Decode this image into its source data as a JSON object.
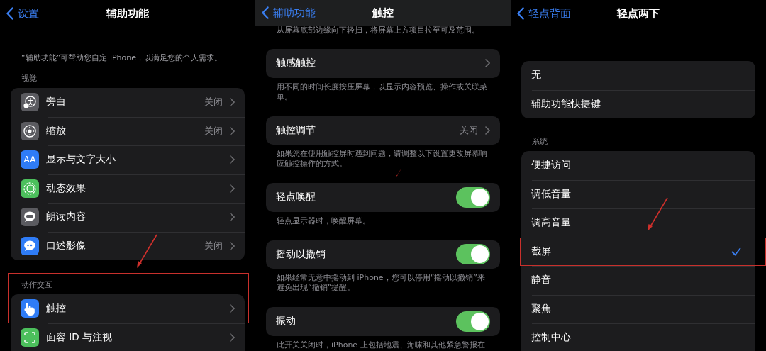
{
  "panels": [
    {
      "back": "设置",
      "title": "辅助功能",
      "scrolled": false,
      "intro": "“辅助功能”可帮助您自定 iPhone，以满足您的个人需求。",
      "groups": [
        {
          "header": "视觉",
          "rows": [
            {
              "label": "旁白",
              "kind": "link",
              "value": "关闭",
              "highlighted": false
            },
            {
              "label": "缩放",
              "kind": "link",
              "value": "关闭",
              "highlighted": false
            },
            {
              "label": "显示与文字大小",
              "kind": "link",
              "icon_text": "AA",
              "highlighted": false
            },
            {
              "label": "动态效果",
              "kind": "link",
              "highlighted": false
            },
            {
              "label": "朗读内容",
              "kind": "link",
              "highlighted": false
            },
            {
              "label": "口述影像",
              "kind": "link",
              "value": "关闭",
              "highlighted": false
            }
          ]
        },
        {
          "header": "动作交互",
          "rows": [
            {
              "label": "触控",
              "kind": "link",
              "highlighted": true
            },
            {
              "label": "面容 ID 与注视",
              "kind": "link",
              "highlighted": false
            }
          ]
        }
      ]
    },
    {
      "back": "辅助功能",
      "title": "触控",
      "scrolled": true,
      "top_note": "从屏幕底部边缘向下轻扫，将屏幕上方项目拉至可及范围。",
      "groups": [
        {
          "rows": [
            {
              "label": "触感触控",
              "kind": "link",
              "highlighted": false
            }
          ],
          "footer": "用不同的时间长度按压屏幕，以显示内容预览、操作或关联菜单。"
        },
        {
          "rows": [
            {
              "label": "触控调节",
              "kind": "link",
              "value": "关闭",
              "highlighted": false
            }
          ],
          "footer": "如果您在使用触控屏时遇到问题，请调整以下设置更改屏幕响应触控操作的方式。"
        },
        {
          "rows": [
            {
              "label": "轻点唤醒",
              "kind": "toggle",
              "on": true,
              "highlighted": true
            }
          ],
          "footer": "轻点显示器时，唤醒屏幕。"
        },
        {
          "rows": [
            {
              "label": "摇动以撤销",
              "kind": "toggle",
              "on": true,
              "highlighted": false
            }
          ],
          "footer": "如果经常无意中摇动到 iPhone，您可以停用“摇动以撤销”来避免出现“撤销”提醒。"
        },
        {
          "rows": [
            {
              "label": "振动",
              "kind": "toggle",
              "on": true,
              "highlighted": false
            }
          ],
          "footer": "此开关关闭时，iPhone 上包括地震、海啸和其他紧急警报在"
        }
      ]
    },
    {
      "back": "轻点背面",
      "title": "轻点两下",
      "scrolled": false,
      "groups": [
        {
          "rows": [
            {
              "label": "无",
              "kind": "option",
              "selected": false,
              "highlighted": false
            },
            {
              "label": "辅助功能快捷键",
              "kind": "option",
              "selected": false,
              "highlighted": false
            }
          ]
        },
        {
          "header": "系统",
          "rows": [
            {
              "label": "便捷访问",
              "kind": "option",
              "selected": false,
              "highlighted": false
            },
            {
              "label": "调低音量",
              "kind": "option",
              "selected": false,
              "highlighted": false
            },
            {
              "label": "调高音量",
              "kind": "option",
              "selected": false,
              "highlighted": false
            },
            {
              "label": "截屏",
              "kind": "option",
              "selected": true,
              "highlighted": true
            },
            {
              "label": "静音",
              "kind": "option",
              "selected": false,
              "highlighted": false
            },
            {
              "label": "聚焦",
              "kind": "option",
              "selected": false,
              "highlighted": false
            },
            {
              "label": "控制中心",
              "kind": "option",
              "selected": false,
              "highlighted": false
            }
          ]
        }
      ]
    }
  ]
}
